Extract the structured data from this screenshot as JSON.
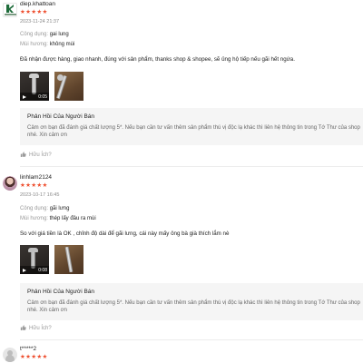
{
  "reviews": [
    {
      "username": "diep.khattoan",
      "stars": "★★★★★",
      "datetime": "2023-11-24 21:37",
      "attrs": [
        {
          "key": "Công dụng:",
          "value": "gai lung"
        },
        {
          "key": "Mùi hương:",
          "value": "không mùi"
        }
      ],
      "comment": "Đã nhận được hàng, giao nhanh, đúng với sản phẩm, thanks shop & shopee, sẽ ủng hộ tiếp nếu gãi hết ngứa.",
      "media": [
        {
          "duration": "0:05"
        },
        {}
      ],
      "reply_title": "Phản Hồi Của Người Bán",
      "reply_text": "Cảm ơn bạn đã đánh giá chất lượng 5*. Nếu bạn cần tư vấn thêm sản phẩm thú vị độc lạ khác thì liên hệ thông tin trong Tớ Thư của shop nhé. Xin cảm ơn",
      "helpful": "Hữu Ích?"
    },
    {
      "username": "linhlam2124",
      "stars": "★★★★★",
      "datetime": "2023-10-17 16:45",
      "attrs": [
        {
          "key": "Công dụng:",
          "value": "gãi lưng"
        },
        {
          "key": "Mùi hương:",
          "value": "thép lấy đâu ra mùi"
        }
      ],
      "comment": "So với giá tiền là OK , chỉnh độ dài để gãi lưng, cái này mấy ông bà già thích lắm nè",
      "media": [
        {
          "duration": "0:08"
        },
        {}
      ],
      "reply_title": "Phản Hồi Của Người Bán",
      "reply_text": "Cảm ơn bạn đã đánh giá chất lượng 5*. Nếu bạn cần tư vấn thêm sản phẩm thú vị độc lạ khác thì liên hệ thông tin trong Tớ Thư của shop nhé. Xin cảm ơn",
      "helpful": "Hữu Ích?"
    },
    {
      "username": "t*****2",
      "stars": "★★★★★"
    }
  ]
}
